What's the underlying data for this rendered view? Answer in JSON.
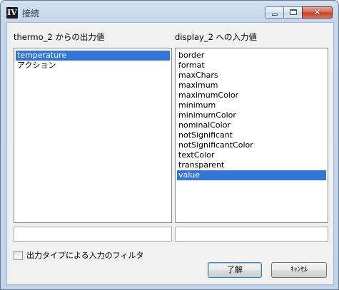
{
  "window": {
    "title": "接続",
    "app_icon": "IV"
  },
  "source": {
    "label": "thermo_2 からの出力値",
    "items": [
      {
        "label": "temperature",
        "selected": true
      },
      {
        "label": "アクション",
        "selected": false
      }
    ],
    "filter_value": ""
  },
  "target": {
    "label": "display_2 への入力値",
    "items": [
      {
        "label": "border",
        "selected": false
      },
      {
        "label": "format",
        "selected": false
      },
      {
        "label": "maxChars",
        "selected": false
      },
      {
        "label": "maximum",
        "selected": false
      },
      {
        "label": "maximumColor",
        "selected": false
      },
      {
        "label": "minimum",
        "selected": false
      },
      {
        "label": "minimumColor",
        "selected": false
      },
      {
        "label": "nominalColor",
        "selected": false
      },
      {
        "label": "notSignificant",
        "selected": false
      },
      {
        "label": "notSignificantColor",
        "selected": false
      },
      {
        "label": "textColor",
        "selected": false
      },
      {
        "label": "transparent",
        "selected": false
      },
      {
        "label": "value",
        "selected": true
      }
    ],
    "filter_value": ""
  },
  "filter_checkbox": {
    "label": "出力タイプによる入力のフィルタ",
    "checked": false
  },
  "buttons": {
    "ok": "了解",
    "cancel": "ｷｬﾝｾﾙ"
  },
  "colors": {
    "selection": "#3375d7",
    "titlebar": "#c4d6eb",
    "close": "#c54128"
  }
}
